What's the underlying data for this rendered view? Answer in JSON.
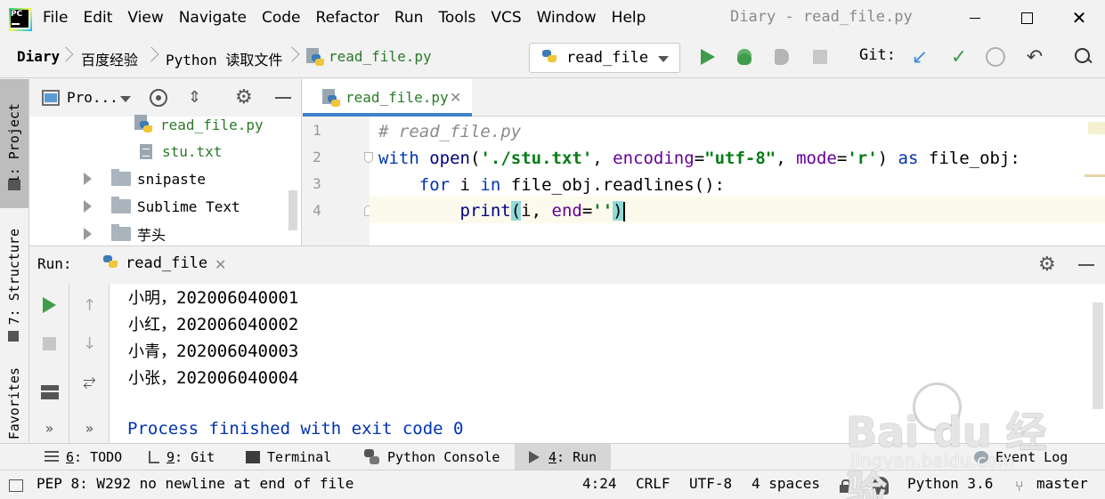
{
  "app": {
    "window_title": "Diary - read_file.py",
    "logo_text": "PC"
  },
  "menu": [
    "File",
    "Edit",
    "View",
    "Navigate",
    "Code",
    "Refactor",
    "Run",
    "Tools",
    "VCS",
    "Window",
    "Help"
  ],
  "window_controls": {
    "close": "✕"
  },
  "breadcrumbs": [
    "Diary",
    "百度经验",
    "Python 读取文件",
    "read_file.py"
  ],
  "toolbar": {
    "run_config": "read_file",
    "git_label": "Git:",
    "icons": [
      "run-icon",
      "debug-icon",
      "coverage-icon",
      "stop-icon",
      "git-update-icon",
      "git-commit-icon",
      "git-history-icon",
      "git-rollback-icon",
      "search-icon"
    ],
    "glyphs": {
      "update": "↙",
      "commit": "✓",
      "rollback": "↶"
    }
  },
  "left_strip": {
    "project": "1: Project",
    "structure": "7: Structure",
    "favorites": "Favorites"
  },
  "project_panel": {
    "title": "Pro...",
    "glyphs": {
      "collapse": "⇕",
      "settings": "⚙"
    },
    "tree": [
      {
        "label": "read_file.py",
        "type": "py"
      },
      {
        "label": "stu.txt",
        "type": "txt"
      },
      {
        "label": "snipaste",
        "type": "folder"
      },
      {
        "label": "Sublime Text",
        "type": "folder"
      },
      {
        "label": "芋头",
        "type": "folder"
      }
    ]
  },
  "editor": {
    "tab": "read_file.py",
    "tab_close": "✕",
    "line_numbers": [
      "1",
      "2",
      "3",
      "4"
    ],
    "code": {
      "l1_comment": "# read_file.py",
      "l2": {
        "kw_with": "with",
        "fn_open": "open",
        "p1": "(",
        "s_path": "'./stu.txt'",
        "comma1": ", ",
        "param_enc": "encoding",
        "eq1": "=",
        "s_enc": "\"utf-8\"",
        "comma2": ", ",
        "param_mode": "mode",
        "eq2": "=",
        "s_mode": "'r'",
        "p2": ") ",
        "kw_as": "as",
        "rest": " file_obj:"
      },
      "l3": {
        "indent": "    ",
        "kw_for": "for",
        "sp1": " i ",
        "kw_in": "in",
        "rest": " file_obj.readlines():"
      },
      "l4": {
        "indent": "        ",
        "fn_print": "print",
        "p1": "(",
        "mid": "i, ",
        "param_end": "end",
        "eq": "=",
        "s_empty": "''",
        "p2": ")"
      }
    }
  },
  "run_panel": {
    "label": "Run:",
    "tab": "read_file",
    "tab_close": "✕",
    "settings_glyph": "⚙",
    "toolbar_glyphs": {
      "up": "↑",
      "down": "↓",
      "wrap": "⥂",
      "more": "»"
    },
    "output": [
      {
        "name": "小明",
        "sep": "，",
        "id": "202006040001"
      },
      {
        "name": "小红",
        "sep": "，",
        "id": "202006040002"
      },
      {
        "name": "小青",
        "sep": "，",
        "id": "202006040003"
      },
      {
        "name": "小张",
        "sep": "，",
        "id": "202006040004"
      }
    ],
    "process_message": "Process finished with exit code 0"
  },
  "bottom_tabs": [
    {
      "key": "6",
      "label": ": TODO"
    },
    {
      "key": "9",
      "label": ": Git"
    },
    {
      "key": "",
      "label": "Terminal"
    },
    {
      "key": "",
      "label": "Python Console"
    },
    {
      "key": "4",
      "label": ": Run"
    },
    {
      "key": "",
      "label": "Event Log"
    }
  ],
  "status_bar": {
    "message": "PEP 8: W292 no newline at end of file",
    "position": "4:24",
    "line_separator": "CRLF",
    "encoding": "UTF-8",
    "indent": "4 spaces",
    "interpreter": "Python 3.6",
    "branch_glyph": "⑂",
    "branch": "master"
  },
  "watermark": {
    "logo": "Bai du 经验",
    "url": "jingyan.baidu.com"
  }
}
